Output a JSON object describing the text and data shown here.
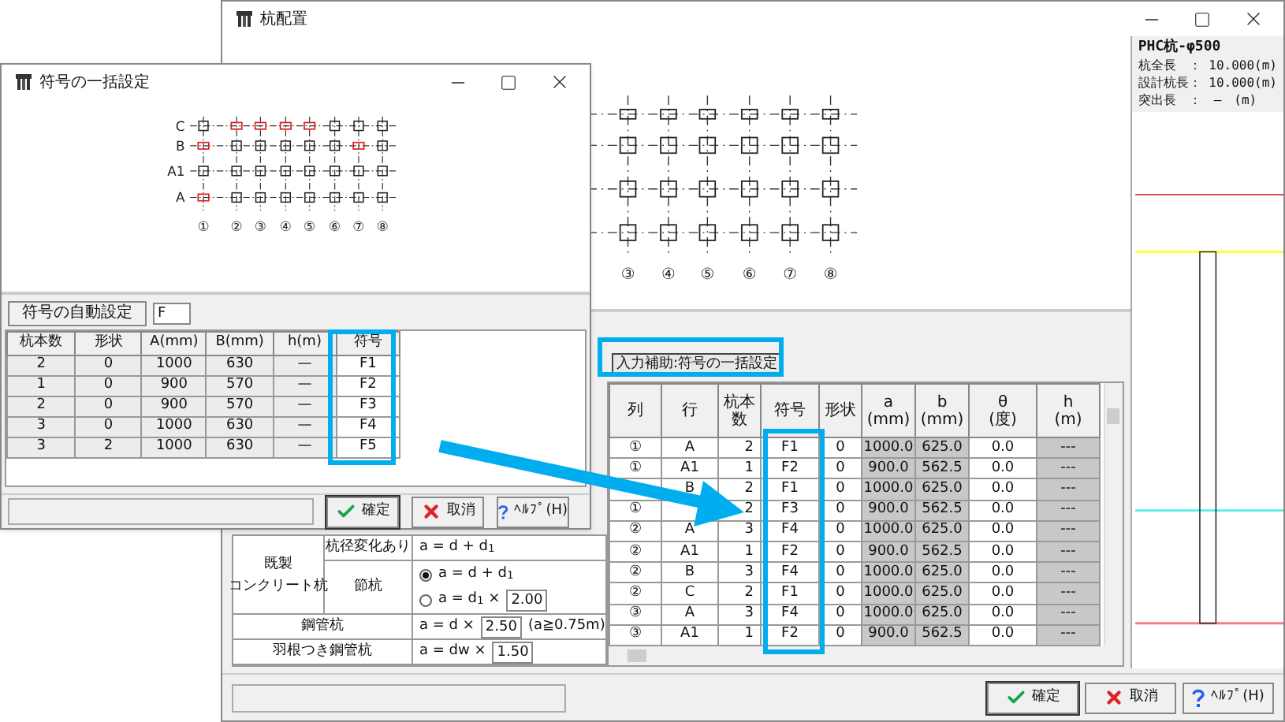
{
  "main_window": {
    "title": "杭配置",
    "plan": {
      "column_labels": [
        "③",
        "④",
        "⑤",
        "⑥",
        "⑦",
        "⑧"
      ]
    },
    "pile_panel": {
      "title": "PHC杭-φ500",
      "lines": [
        "杭全長　： 10.000(m)",
        "設計杭長： 10.000(m)",
        "突出長　：　—　(m)"
      ]
    },
    "formula_table": {
      "group_label": [
        "既製",
        "コンクリート杭"
      ],
      "rows": [
        {
          "label": "杭径変化あり",
          "formula": "a = d + d$_{1}$"
        },
        {
          "label": "節杭",
          "options": [
            {
              "text": "a = d + d$_{1}$",
              "selected": true
            },
            {
              "text": "a = d$_{1}$ ×",
              "value": "2.00",
              "selected": false
            }
          ]
        }
      ],
      "steel": [
        {
          "label": "鋼管杭",
          "formula": "a = d ×",
          "value": "2.50",
          "note": "(a≧0.75m)"
        },
        {
          "label": "羽根つき鋼管杭",
          "formula": "a = dw ×",
          "value": "1.50"
        }
      ]
    },
    "assist_button": "入力補助:符号の一括設定",
    "table": {
      "columns": [
        {
          "label": "列",
          "shaded": false
        },
        {
          "label": "行",
          "shaded": false
        },
        {
          "label": "杭本数",
          "shaded": false
        },
        {
          "label": "符号",
          "shaded": false
        },
        {
          "label": "形状",
          "shaded": false
        },
        {
          "label": "a",
          "unit": "(mm)",
          "shaded": true
        },
        {
          "label": "b",
          "unit": "(mm)",
          "shaded": true
        },
        {
          "label": "θ",
          "unit": "(度)",
          "shaded": false
        },
        {
          "label": "h",
          "unit": "(m)",
          "shaded": true
        }
      ],
      "rows": [
        {
          "cells": [
            "①",
            "A",
            "2",
            "F1",
            "0",
            "1000.0",
            "625.0",
            "0.0",
            "---"
          ]
        },
        {
          "cells": [
            "①",
            "A1",
            "1",
            "F2",
            "0",
            "900.0",
            "562.5",
            "0.0",
            "---"
          ]
        },
        {
          "cells": [
            null,
            "B",
            "2",
            "F1",
            "0",
            "1000.0",
            "625.0",
            "0.0",
            "---"
          ]
        },
        {
          "cells": [
            "①",
            null,
            "2",
            "F3",
            "0",
            "900.0",
            "562.5",
            "0.0",
            "---"
          ]
        },
        {
          "cells": [
            "②",
            "A",
            "3",
            "F4",
            "0",
            "1000.0",
            "625.0",
            "0.0",
            "---"
          ]
        },
        {
          "cells": [
            "②",
            "A1",
            "1",
            "F2",
            "0",
            "900.0",
            "562.5",
            "0.0",
            "---"
          ]
        },
        {
          "cells": [
            "②",
            "B",
            "3",
            "F4",
            "0",
            "1000.0",
            "625.0",
            "0.0",
            "---"
          ]
        },
        {
          "cells": [
            "②",
            "C",
            "2",
            "F1",
            "0",
            "1000.0",
            "625.0",
            "0.0",
            "---"
          ]
        },
        {
          "cells": [
            "③",
            "A",
            "3",
            "F4",
            "0",
            "1000.0",
            "625.0",
            "0.0",
            "---"
          ]
        },
        {
          "cells": [
            "③",
            "A1",
            "1",
            "F2",
            "0",
            "900.0",
            "562.5",
            "0.0",
            "---"
          ]
        }
      ]
    },
    "buttons": [
      {
        "kind": "ok",
        "label": "確定"
      },
      {
        "kind": "cancel",
        "label": "取消"
      },
      {
        "kind": "help",
        "label": "ﾍﾙﾌﾟ(H)"
      }
    ]
  },
  "dialog": {
    "title": "符号の一括設定",
    "plan": {
      "column_labels": [
        "①",
        "②",
        "③",
        "④",
        "⑤",
        "⑥",
        "⑦",
        "⑧"
      ],
      "rows": [
        {
          "label": "C",
          "marked": [
            false,
            true,
            true,
            true,
            true,
            false,
            false,
            false
          ]
        },
        {
          "label": "B",
          "marked": [
            true,
            false,
            false,
            false,
            false,
            false,
            true,
            false
          ]
        },
        {
          "label": "A1",
          "marked": [
            false,
            false,
            false,
            false,
            false,
            false,
            false,
            false
          ]
        },
        {
          "label": "A",
          "marked": [
            true,
            false,
            false,
            false,
            false,
            false,
            false,
            false
          ]
        }
      ]
    },
    "auto_button": "符号の自動設定",
    "prefix_value": "F",
    "table": {
      "columns": [
        {
          "label": "杭本数",
          "editable": false
        },
        {
          "label": "形状",
          "editable": false
        },
        {
          "label": "A(mm)",
          "editable": false
        },
        {
          "label": "B(mm)",
          "editable": false
        },
        {
          "label": "h(m)",
          "editable": false
        },
        {
          "label": "符号",
          "editable": true
        }
      ],
      "rows": [
        [
          "2",
          "0",
          "1000",
          "630",
          "—",
          "F1"
        ],
        [
          "1",
          "0",
          "900",
          "570",
          "—",
          "F2"
        ],
        [
          "2",
          "0",
          "900",
          "570",
          "—",
          "F3"
        ],
        [
          "3",
          "0",
          "1000",
          "630",
          "—",
          "F4"
        ],
        [
          "3",
          "2",
          "1000",
          "630",
          "—",
          "F5"
        ]
      ]
    },
    "buttons": [
      {
        "kind": "ok",
        "label": "確定"
      },
      {
        "kind": "cancel",
        "label": "取消"
      },
      {
        "kind": "help",
        "label": "ﾍﾙﾌﾟ(H)"
      }
    ]
  }
}
